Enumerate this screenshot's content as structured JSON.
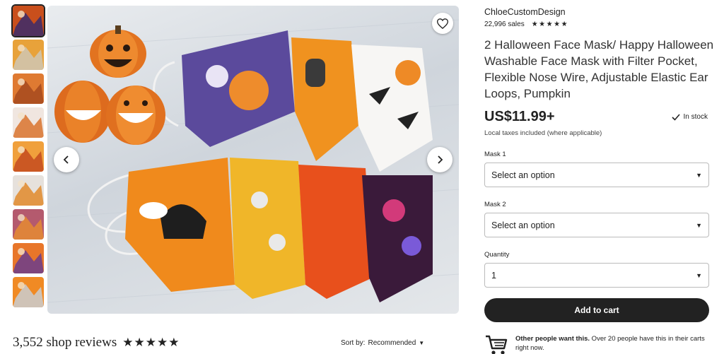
{
  "thumbnails": [
    {
      "name": "thumb-1",
      "bg": "#c94f1c",
      "fg": "#3b2a6b"
    },
    {
      "name": "thumb-2",
      "bg": "#e8a23a",
      "fg": "#cfc7b4"
    },
    {
      "name": "thumb-3",
      "bg": "#df7a32",
      "fg": "#a74a1e"
    },
    {
      "name": "thumb-4",
      "bg": "#f0e6e0",
      "fg": "#d9732e"
    },
    {
      "name": "thumb-5",
      "bg": "#f0a03c",
      "fg": "#c44b1f"
    },
    {
      "name": "thumb-6",
      "bg": "#e6e1dc",
      "fg": "#e08a2c"
    },
    {
      "name": "thumb-7",
      "bg": "#b45a6e",
      "fg": "#e58b33"
    },
    {
      "name": "thumb-8",
      "bg": "#e8762a",
      "fg": "#6b3d8c"
    },
    {
      "name": "thumb-9",
      "bg": "#f08a24",
      "fg": "#c9cdd1"
    }
  ],
  "reviews": {
    "title": "3,552 shop reviews",
    "stars": "★★★★★",
    "sort_label": "Sort by:",
    "sort_value": "Recommended",
    "sort_caret": "▼"
  },
  "shop": {
    "name": "ChloeCustomDesign",
    "sales": "22,996 sales",
    "stars": "★★★★★"
  },
  "listing": {
    "title": "2 Halloween Face Mask/ Happy Halloween Washable Face Mask with Filter Pocket, Flexible Nose Wire, Adjustable Elastic Ear Loops, Pumpkin",
    "price": "US$11.99+",
    "stock": "In stock",
    "taxes": "Local taxes included (where applicable)"
  },
  "options": {
    "mask1": {
      "label": "Mask 1",
      "value": "Select an option"
    },
    "mask2": {
      "label": "Mask 2",
      "value": "Select an option"
    },
    "quantity": {
      "label": "Quantity",
      "value": "1"
    },
    "caret": "▼"
  },
  "cart": {
    "button_label": "Add to cart"
  },
  "social_proof": {
    "bold": "Other people want this.",
    "text": " Over 20 people have this in their carts right now."
  },
  "colors": {
    "primary_button": "#222222",
    "border": "#bbbbbb"
  }
}
